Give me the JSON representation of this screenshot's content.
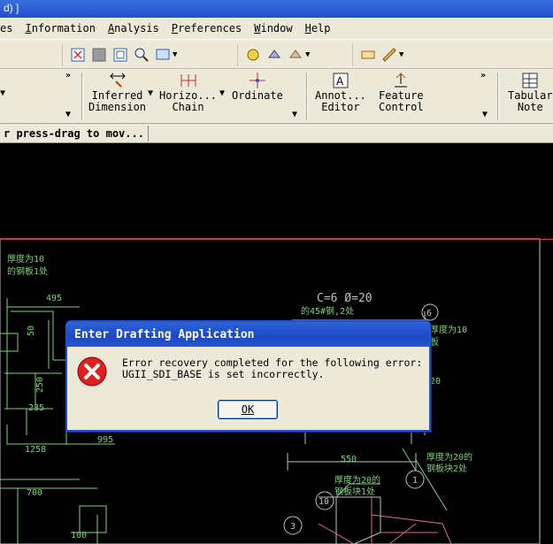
{
  "window": {
    "title_fragment": "d) ]"
  },
  "menu": [
    {
      "label": "es",
      "key": ""
    },
    {
      "label": "Information",
      "key": "I"
    },
    {
      "label": "Analysis",
      "key": "A"
    },
    {
      "label": "Preferences",
      "key": "P"
    },
    {
      "label": "Window",
      "key": "W"
    },
    {
      "label": "Help",
      "key": "H"
    }
  ],
  "toolbar": {
    "inferred": "Inferred\nDimension",
    "horizontal_chain": "Horizo...\nChain",
    "ordinate": "Ordinate",
    "annotation_editor": "Annot...\nEditor",
    "feature_control": "Feature\nControl",
    "tabular_note": "Tabular\nNote"
  },
  "status": {
    "prompt": "r press-drag to mov..."
  },
  "drawing": {
    "labels": {
      "a": "厚度为10",
      "b": "的钢板1处",
      "c": "495",
      "d": "C=6 Ø=20",
      "e": "的45#钢,2处",
      "f": "50",
      "g": "250",
      "h": "235",
      "i": "995",
      "j": "1258",
      "k": "700",
      "l": "550",
      "m": "厚度为20的",
      "n": "钢板块1处",
      "o": "厚度为20的",
      "p": "钢板块2处",
      "q": "厚度为10",
      "r": "板",
      "s": "20",
      "t": "100",
      "b6": "6",
      "b1": "1",
      "b10": "10",
      "b3": "3"
    }
  },
  "dialog": {
    "title": "Enter Drafting Application",
    "message": "Error recovery completed for the following error:\nUGII_SDI_BASE is set incorrectly.",
    "ok_label": "OK"
  }
}
